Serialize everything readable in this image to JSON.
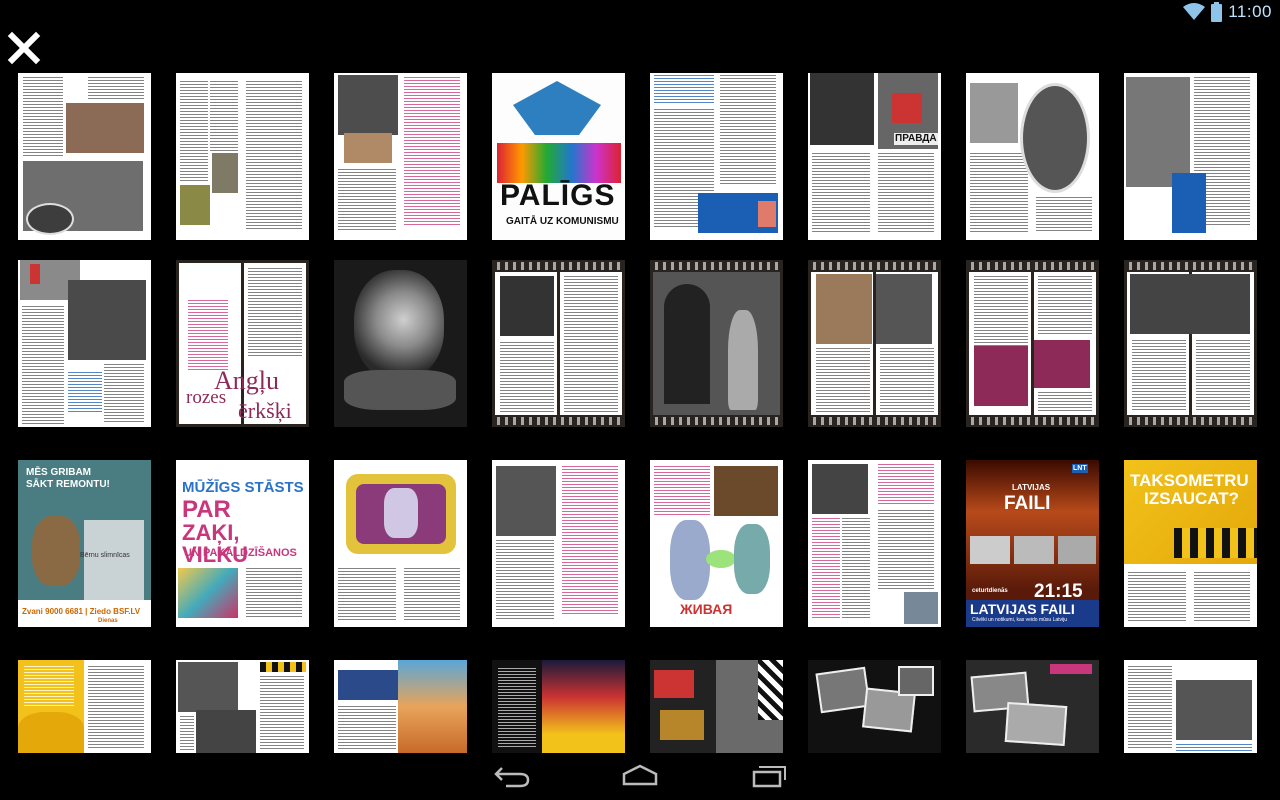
{
  "status": {
    "time": "11:00"
  },
  "icons": {
    "close": "close-icon",
    "wifi": "wifi-icon",
    "battery": "battery-icon",
    "back": "back-icon",
    "home": "home-icon",
    "recents": "recents-icon"
  },
  "thumbnails": [
    {
      "texts": []
    },
    {
      "texts": []
    },
    {
      "texts": []
    },
    {
      "texts": [
        "PALĪGS",
        "GAITĀ UZ KOMUNISMU"
      ]
    },
    {
      "texts": []
    },
    {
      "texts": [
        "ПРАВДА"
      ]
    },
    {
      "texts": []
    },
    {
      "texts": []
    },
    {
      "texts": []
    },
    {
      "texts": [
        "Angļu",
        "rozes",
        "ērkšķi"
      ]
    },
    {
      "texts": []
    },
    {
      "texts": []
    },
    {
      "texts": []
    },
    {
      "texts": []
    },
    {
      "texts": []
    },
    {
      "texts": []
    },
    {
      "texts": [
        "MĒS GRIBAM",
        "SĀKT REMONTU!",
        "Bērnu slimnīcas",
        "Zvani 9000 6681 | Ziedo BSF.LV",
        "Dienas"
      ]
    },
    {
      "texts": [
        "MŪŽĪGS STĀSTS",
        "PAR",
        "ZAĶI, VILKU",
        "UN PAKALDZĪŠANOS"
      ]
    },
    {
      "texts": []
    },
    {
      "texts": []
    },
    {
      "texts": [
        "ЖИВАЯ"
      ]
    },
    {
      "texts": []
    },
    {
      "texts": [
        "LNT",
        "LATVIJAS",
        "FAILI",
        "21:15",
        "ceturtdienās",
        "LATVIJAS FAILI",
        "Cilvēki un notikumi, kas veido mūsu Latviju"
      ]
    },
    {
      "texts": [
        "TAKSOMETRU",
        "IZSAUCAT?"
      ]
    },
    {
      "texts": []
    },
    {
      "texts": []
    },
    {
      "texts": []
    },
    {
      "texts": []
    },
    {
      "texts": []
    },
    {
      "texts": []
    },
    {
      "texts": []
    },
    {
      "texts": []
    }
  ]
}
